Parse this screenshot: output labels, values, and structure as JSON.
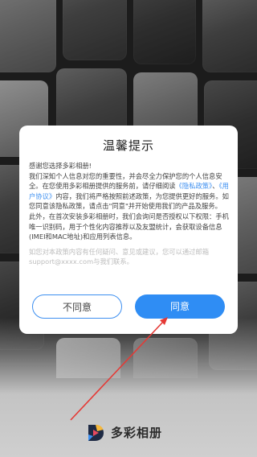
{
  "dialog": {
    "title": "温馨提示",
    "body": {
      "greeting": "感谢您选择多彩相册!",
      "p1_a": "我们深知个人信息对您的重要性，并会尽全力保护您的个人信息安全。在您使用多彩相册提供的服务前，请仔细阅读",
      "privacy_link": "《隐私政策》",
      "p1_b": "、",
      "user_agreement_link": "《用户协议》",
      "p1_c": "内容，我们将严格按照前述政策，为您提供更好的服务。如您同意该隐私政策，请点击\"同意\"并开始使用我们的产品及服务。",
      "p2": "此外，在首次安装多彩相册时，我们会询问是否授权以下权限：手机唯一识别码，用于个性化内容推荐以及友盟统计，会获取设备信息(IMEI和MAC地址)和应用列表信息。",
      "p3_faded": "如您对本政策内容有任何疑问、意见或建议，您可以通过邮箱support@xxxx.com与我们联系。"
    },
    "buttons": {
      "disagree": "不同意",
      "agree": "同意"
    }
  },
  "brand": {
    "name": "多彩相册",
    "logo_icon": "app-logo-icon"
  },
  "colors": {
    "accent": "#2f8df4",
    "link": "#3d8ff0",
    "annotation_arrow": "#e53935"
  }
}
